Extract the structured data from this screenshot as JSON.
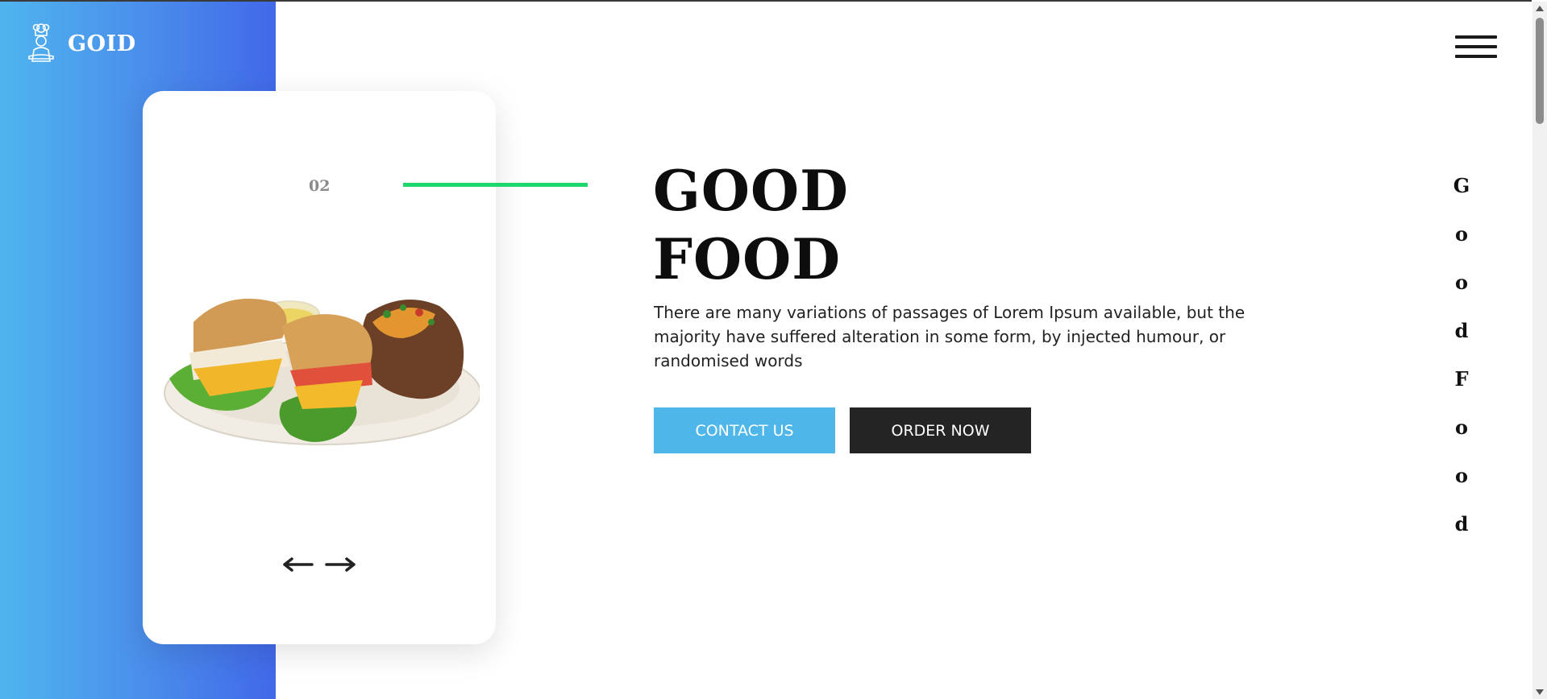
{
  "brand": {
    "name": "GOID",
    "logo_icon": "chef-icon"
  },
  "menu": {
    "icon": "hamburger-menu-icon"
  },
  "slider": {
    "current_slide": "02",
    "prev_icon": "arrow-left-icon",
    "next_icon": "arrow-right-icon",
    "image": "sandwich-plate-image"
  },
  "hero": {
    "title_line1": "GOOD",
    "title_line2": "FOOD",
    "description": "There are many variations of passages of Lorem Ipsum available, but the majority have suffered alteration in some form, by injected humour, or randomised words",
    "contact_label": "CONTACT US",
    "order_label": "ORDER NOW"
  },
  "side_text": {
    "letters": [
      "G",
      "o",
      "o",
      "d",
      "F",
      "o",
      "o",
      "d"
    ]
  },
  "colors": {
    "gradient_start": "#4fb5ee",
    "gradient_end": "#4169e9",
    "accent_line": "#1ed76f",
    "contact_button": "#4fb6ea",
    "order_button": "#242424"
  }
}
